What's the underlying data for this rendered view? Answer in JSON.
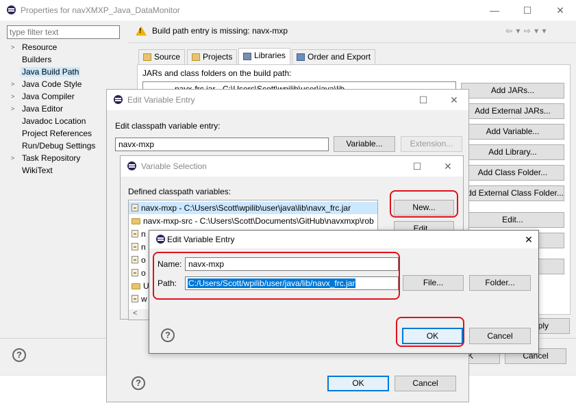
{
  "properties": {
    "title": "Properties for navXMXP_Java_DataMonitor",
    "filter_placeholder": "type filter text",
    "tree": [
      {
        "label": "Resource",
        "expandable": true
      },
      {
        "label": "Builders",
        "expandable": false
      },
      {
        "label": "Java Build Path",
        "expandable": false,
        "selected": true
      },
      {
        "label": "Java Code Style",
        "expandable": true
      },
      {
        "label": "Java Compiler",
        "expandable": true
      },
      {
        "label": "Java Editor",
        "expandable": true
      },
      {
        "label": "Javadoc Location",
        "expandable": false
      },
      {
        "label": "Project References",
        "expandable": false
      },
      {
        "label": "Run/Debug Settings",
        "expandable": false
      },
      {
        "label": "Task Repository",
        "expandable": true
      },
      {
        "label": "WikiText",
        "expandable": false
      }
    ],
    "warning": "Build path entry is missing: navx-mxp",
    "tabs": [
      "Source",
      "Projects",
      "Libraries",
      "Order and Export"
    ],
    "active_tab": "Libraries",
    "jars_label": "JARs and class folders on the build path:",
    "jar_entry": "navx-frc.jar - C:\\Users\\Scott\\wpilib\\user\\java\\lib",
    "side_buttons": [
      "Add JARs...",
      "Add External JARs...",
      "Add Variable...",
      "Add Library...",
      "Add Class Folder...",
      "Add External Class Folder...",
      "Edit..."
    ],
    "apply_label": "Apply",
    "ok_label": "OK",
    "cancel_label": "Cancel"
  },
  "edit_var_back": {
    "title": "Edit Variable Entry",
    "prompt": "Edit classpath variable entry:",
    "value": "navx-mxp",
    "variable_btn": "Variable...",
    "extension_btn": "Extension...",
    "ok_label": "OK",
    "cancel_label": "Cancel"
  },
  "var_selection": {
    "title": "Variable Selection",
    "defined_label": "Defined classpath variables:",
    "items": [
      {
        "text": "navx-mxp - C:\\Users\\Scott\\wpilib\\user\\java\\lib\\navx_frc.jar",
        "icon": "jar",
        "selected": true
      },
      {
        "text": "navx-mxp-src - C:\\Users\\Scott\\Documents\\GitHub\\navxmxp\\rob",
        "icon": "folder"
      },
      {
        "text": "n",
        "icon": "jar"
      },
      {
        "text": "n",
        "icon": "jar"
      },
      {
        "text": "o",
        "icon": "jar"
      },
      {
        "text": "o",
        "icon": "jar"
      },
      {
        "text": "U",
        "icon": "folder"
      },
      {
        "text": "w",
        "icon": "jar"
      }
    ],
    "new_btn": "New...",
    "edit_btn": "Edit..."
  },
  "edit_var_front": {
    "title": "Edit Variable Entry",
    "name_label": "Name:",
    "name_value": "navx-mxp",
    "path_label": "Path:",
    "path_value": "C:/Users/Scott/wpilib/user/java/lib/navx_frc.jar",
    "file_btn": "File...",
    "folder_btn": "Folder...",
    "ok_label": "OK",
    "cancel_label": "Cancel"
  },
  "glyphs": {
    "minimize": "—",
    "maximize": "☐",
    "close": "✕",
    "help": "?",
    "warning": "!",
    "expand": ">",
    "nav": "⇦ ▾ ⇨ ▾ ▾",
    "scroll_left": "<"
  },
  "colors": {
    "highlight": "#cce8ff",
    "ring": "#e0101a",
    "accent": "#0078d7"
  }
}
